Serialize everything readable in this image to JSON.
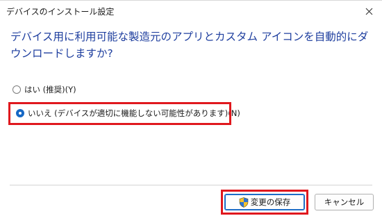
{
  "window": {
    "title": "デバイスのインストール設定"
  },
  "heading": "デバイス用に利用可能な製造元のアプリとカスタム アイコンを自動的にダウンロードしますか?",
  "options": [
    {
      "label": "はい (推奨)(Y)",
      "selected": false
    },
    {
      "label": "いいえ (デバイスが適切に機能しない可能性があります)(N)",
      "selected": true
    }
  ],
  "buttons": {
    "save_label": "変更の保存",
    "cancel_label": "キャンセル"
  },
  "colors": {
    "heading": "#1f3f9f",
    "highlight": "#e0181e",
    "accent": "#1668c5"
  },
  "icons": {
    "close": "close-icon",
    "save": "uac-shield-icon"
  }
}
